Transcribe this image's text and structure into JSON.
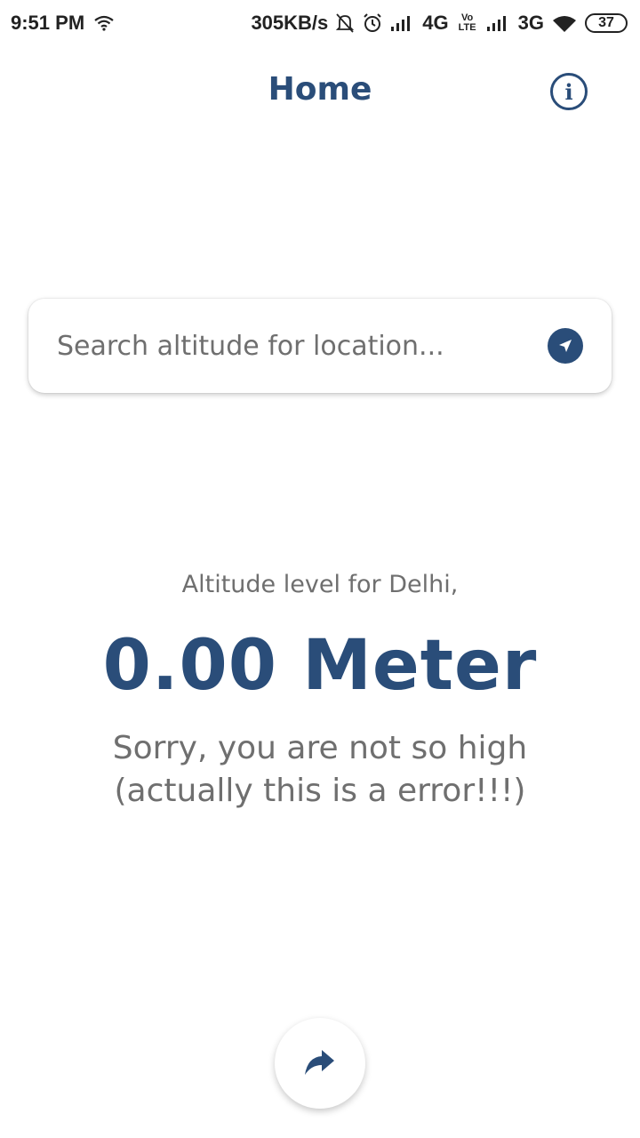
{
  "status_bar": {
    "time": "9:51 PM",
    "speed": "305KB/s",
    "network_1": "4G",
    "volte": "Vo LTE",
    "network_2": "3G",
    "battery": "37",
    "icons": [
      "wifi-icon",
      "bell-muted-icon",
      "alarm-icon",
      "signal-icon",
      "wifi-icon"
    ]
  },
  "header": {
    "title": "Home",
    "info_icon": "info-icon"
  },
  "search": {
    "placeholder": "Search altitude for location...",
    "locate_icon": "navigation-arrow-icon"
  },
  "result": {
    "label": "Altitude level for Delhi,",
    "value": "0.00 Meter",
    "message_line1": "Sorry, you are not so high",
    "message_line2": "(actually this is a error!!!)"
  },
  "fab": {
    "icon": "share-icon"
  },
  "colors": {
    "primary": "#2a4d79",
    "text_secondary": "#6f6f6f",
    "background": "#ffffff"
  }
}
